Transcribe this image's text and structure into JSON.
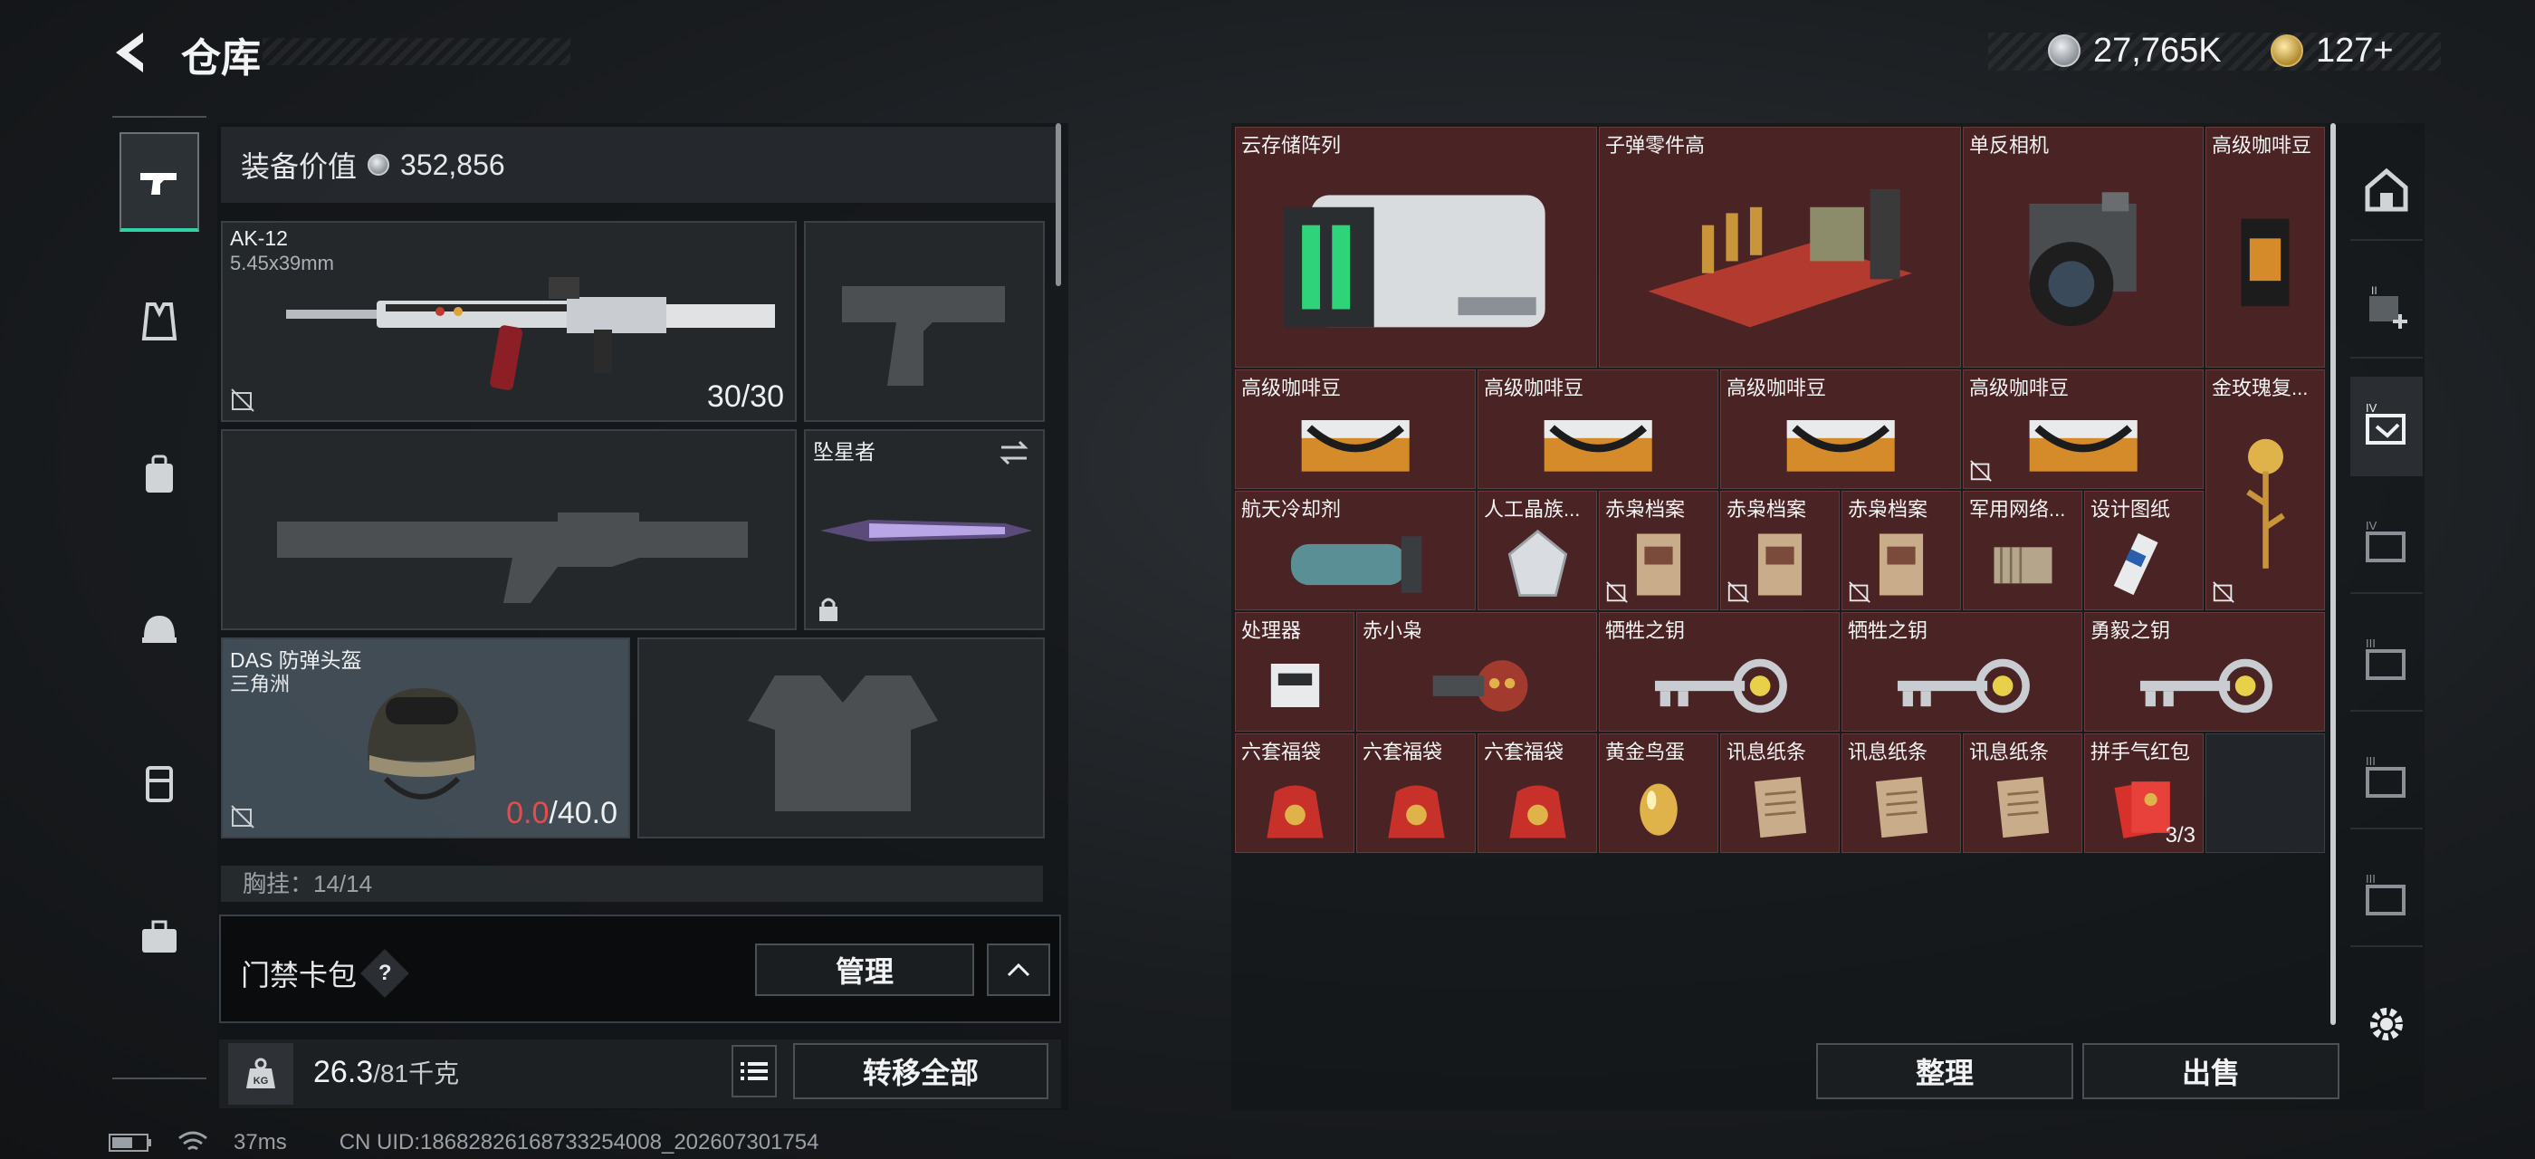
{
  "header": {
    "title": "仓库",
    "currency1": "27,765K",
    "currency2": "127+"
  },
  "equipment": {
    "value_label": "装备价值",
    "value": "352,856",
    "primary": {
      "name": "AK-12",
      "caliber": "5.45x39mm",
      "ammo": "30/30"
    },
    "melee": {
      "name": "坠星者"
    },
    "helmet": {
      "name": "DAS 防弹头盔",
      "origin": "三角洲",
      "durability_current": "0.0",
      "durability_max": "/40.0"
    },
    "chest_hint": "胸挂：14/14"
  },
  "keycard": {
    "label": "门禁卡包",
    "help": "?",
    "manage": "管理"
  },
  "weight": {
    "current": "26.3",
    "max": "/81千克",
    "transfer_all": "转移全部"
  },
  "stash": {
    "items": [
      {
        "name": "云存储阵列",
        "icon": "server-icon"
      },
      {
        "name": "子弹零件高",
        "icon": "ammo-parts-icon"
      },
      {
        "name": "单反相机",
        "icon": "camera-icon"
      },
      {
        "name": "高级咖啡豆",
        "icon": "coffee-bag-icon"
      },
      {
        "name": "高级咖啡豆",
        "icon": "coffee-box-icon"
      },
      {
        "name": "高级咖啡豆",
        "icon": "coffee-box-icon"
      },
      {
        "name": "高级咖啡豆",
        "icon": "coffee-box-icon"
      },
      {
        "name": "高级咖啡豆",
        "icon": "coffee-box-icon"
      },
      {
        "name": "金玫瑰复...",
        "icon": "gold-rose-icon"
      },
      {
        "name": "航天冷却剂",
        "icon": "coolant-icon"
      },
      {
        "name": "人工晶族...",
        "icon": "crystal-icon"
      },
      {
        "name": "赤枭档案",
        "icon": "document-icon"
      },
      {
        "name": "赤枭档案",
        "icon": "document-icon"
      },
      {
        "name": "赤枭档案",
        "icon": "document-icon"
      },
      {
        "name": "军用网络...",
        "icon": "network-module-icon"
      },
      {
        "name": "设计图纸",
        "icon": "blueprint-icon"
      },
      {
        "name": "处理器",
        "icon": "processor-icon"
      },
      {
        "name": "赤小枭",
        "icon": "owl-figure-icon"
      },
      {
        "name": "牺牲之钥",
        "icon": "key-icon"
      },
      {
        "name": "牺牲之钥",
        "icon": "key-icon"
      },
      {
        "name": "勇毅之钥",
        "icon": "key-icon"
      },
      {
        "name": "六套福袋",
        "icon": "lucky-bag-icon"
      },
      {
        "name": "六套福袋",
        "icon": "lucky-bag-icon"
      },
      {
        "name": "六套福袋",
        "icon": "lucky-bag-icon"
      },
      {
        "name": "黄金鸟蛋",
        "icon": "golden-egg-icon"
      },
      {
        "name": "讯息纸条",
        "icon": "paper-note-icon"
      },
      {
        "name": "讯息纸条",
        "icon": "paper-note-icon"
      },
      {
        "name": "讯息纸条",
        "icon": "paper-note-icon"
      },
      {
        "name": "拼手气红包",
        "icon": "red-envelope-icon",
        "count": "3/3"
      }
    ],
    "sort_button": "整理",
    "sell_button": "出售"
  },
  "status": {
    "ping": "37ms",
    "uid": "CN UID:18682826168733254008_202607301754"
  },
  "colors": {
    "accent": "#2fd3a5",
    "cell_bg": "#4a2324",
    "alert": "#e84b4b"
  }
}
